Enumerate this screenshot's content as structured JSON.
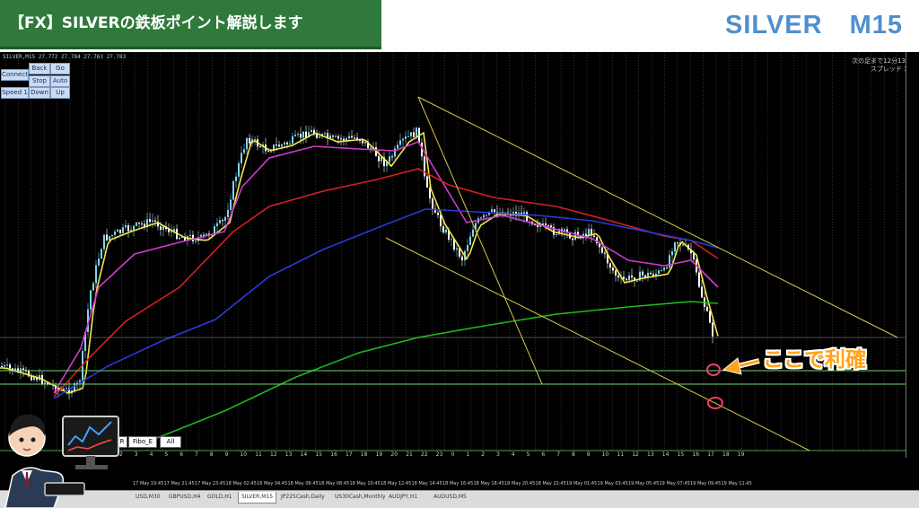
{
  "header": {
    "banner_title": "【FX】SILVERの鉄板ポイント解説します",
    "symbol": "SILVER",
    "timeframe": "M15"
  },
  "chart": {
    "symbol_info": "SILVER,M15 27.772 27.784 27.763 27.783",
    "bar_info_line1": "次の足まで12分13秒",
    "bar_info_line2": "スプレッド 30",
    "annotation": "ここで利確",
    "colors": {
      "banner": "#2f7a3b",
      "symbol_title": "#4f8fd0",
      "annotation": "#ffa31a",
      "ema_fast": "#f2e64a",
      "ema_magenta": "#d23bd2",
      "ema_red": "#d42020",
      "ema_blue": "#2a3ad8",
      "ema_green": "#1fb81f",
      "trendline": "#d8c84a",
      "horizontal": "#6fd36f",
      "circle": "#ff3b6b"
    }
  },
  "controls": {
    "connect": "Connect",
    "back": "Back",
    "go": "Go",
    "stop": "Stop",
    "auto": "Auto",
    "speed": "Speed 1",
    "down": "Down",
    "up": "Up",
    "r": "R",
    "fibo": "Fibo_E",
    "all": "All"
  },
  "time_axis": {
    "hours": [
      "2",
      "3",
      "4",
      "5",
      "6",
      "7",
      "8",
      "9",
      "10",
      "11",
      "12",
      "13",
      "14",
      "15",
      "16",
      "17",
      "18",
      "19",
      "20",
      "21",
      "22",
      "23",
      "0",
      "1",
      "2",
      "3",
      "4",
      "5",
      "6",
      "7",
      "8",
      "9",
      "10",
      "11",
      "12",
      "13",
      "14",
      "15",
      "16",
      "17",
      "18",
      "19"
    ],
    "labels": [
      "17 May 19:45",
      "17 May 21:45",
      "17 May 23:45",
      "18 May 02:45",
      "18 May 04:45",
      "18 May 06:45",
      "18 May 08:45",
      "18 May 10:45",
      "18 May 12:45",
      "18 May 14:45",
      "18 May 16:45",
      "18 May 18:45",
      "18 May 20:45",
      "18 May 22:45",
      "19 May 01:45",
      "19 May 03:45",
      "19 May 05:45",
      "19 May 07:45",
      "19 May 09:45",
      "19 May 11:45"
    ]
  },
  "tabs": [
    "USD,M30",
    "GBPUSD,H4",
    "GOLD,H1",
    "SILVER,M15",
    "JP225Cash,Daily",
    "US30Cash,Monthly",
    "AUDJPY,H1",
    "AUDUSD,M5"
  ],
  "active_tab_index": 3
}
